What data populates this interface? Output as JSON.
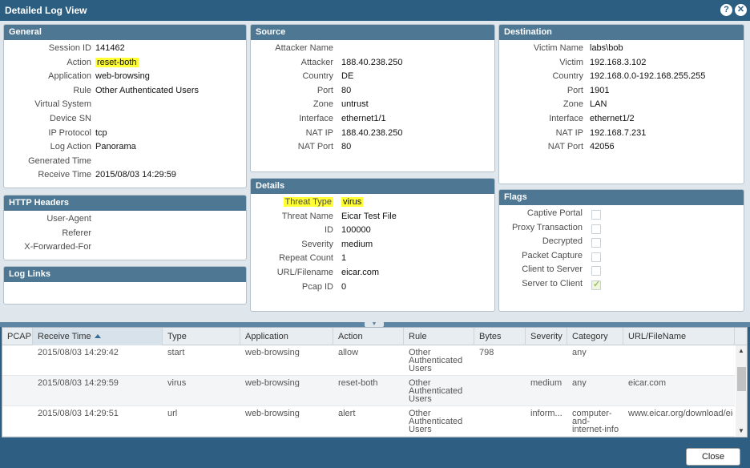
{
  "window": {
    "title": "Detailed Log View"
  },
  "general": {
    "header": "General",
    "rows": [
      {
        "label": "Session ID",
        "value": "141462"
      },
      {
        "label": "Action",
        "value": "reset-both"
      },
      {
        "label": "Application",
        "value": "web-browsing"
      },
      {
        "label": "Rule",
        "value": "Other Authenticated Users"
      },
      {
        "label": "Virtual System",
        "value": ""
      },
      {
        "label": "Device SN",
        "value": ""
      },
      {
        "label": "IP Protocol",
        "value": "tcp"
      },
      {
        "label": "Log Action",
        "value": "Panorama"
      },
      {
        "label": "Generated Time",
        "value": ""
      },
      {
        "label": "Receive Time",
        "value": "2015/08/03 14:29:59"
      }
    ]
  },
  "http_headers": {
    "header": "HTTP Headers",
    "rows": [
      {
        "label": "User-Agent",
        "value": ""
      },
      {
        "label": "Referer",
        "value": ""
      },
      {
        "label": "X-Forwarded-For",
        "value": ""
      }
    ]
  },
  "log_links": {
    "header": "Log Links"
  },
  "source": {
    "header": "Source",
    "rows": [
      {
        "label": "Attacker Name",
        "value": ""
      },
      {
        "label": "Attacker",
        "value": "188.40.238.250"
      },
      {
        "label": "Country",
        "value": "DE"
      },
      {
        "label": "Port",
        "value": "80"
      },
      {
        "label": "Zone",
        "value": "untrust"
      },
      {
        "label": "Interface",
        "value": "ethernet1/1"
      },
      {
        "label": "NAT IP",
        "value": "188.40.238.250"
      },
      {
        "label": "NAT Port",
        "value": "80"
      }
    ]
  },
  "details": {
    "header": "Details",
    "rows": [
      {
        "label": "Threat Type",
        "value": "virus"
      },
      {
        "label": "Threat Name",
        "value": "Eicar Test File"
      },
      {
        "label": "ID",
        "value": "100000"
      },
      {
        "label": "Severity",
        "value": "medium"
      },
      {
        "label": "Repeat Count",
        "value": "1"
      },
      {
        "label": "URL/Filename",
        "value": "eicar.com"
      },
      {
        "label": "Pcap ID",
        "value": "0"
      }
    ]
  },
  "destination": {
    "header": "Destination",
    "rows": [
      {
        "label": "Victim Name",
        "value": "labs\\bob"
      },
      {
        "label": "Victim",
        "value": "192.168.3.102"
      },
      {
        "label": "Country",
        "value": "192.168.0.0-192.168.255.255"
      },
      {
        "label": "Port",
        "value": "1901"
      },
      {
        "label": "Zone",
        "value": "LAN"
      },
      {
        "label": "Interface",
        "value": "ethernet1/2"
      },
      {
        "label": "NAT IP",
        "value": "192.168.7.231"
      },
      {
        "label": "NAT Port",
        "value": "42056"
      }
    ]
  },
  "flags": {
    "header": "Flags",
    "rows": [
      {
        "label": "Captive Portal",
        "checked": false
      },
      {
        "label": "Proxy Transaction",
        "checked": false
      },
      {
        "label": "Decrypted",
        "checked": false
      },
      {
        "label": "Packet Capture",
        "checked": false
      },
      {
        "label": "Client to Server",
        "checked": false
      },
      {
        "label": "Server to Client",
        "checked": true
      }
    ]
  },
  "table": {
    "columns": [
      "PCAP",
      "Receive Time",
      "Type",
      "Application",
      "Action",
      "Rule",
      "Bytes",
      "Severity",
      "Category",
      "URL/FileName"
    ],
    "sorted_column": "Receive Time",
    "sort_direction": "ascending",
    "rows": [
      {
        "pcap": "",
        "receive_time": "2015/08/03 14:29:42",
        "type": "start",
        "application": "web-browsing",
        "action": "allow",
        "rule": "Other Authenticated Users",
        "bytes": "798",
        "severity": "",
        "category": "any",
        "url": ""
      },
      {
        "pcap": "",
        "receive_time": "2015/08/03 14:29:59",
        "type": "virus",
        "application": "web-browsing",
        "action": "reset-both",
        "rule": "Other Authenticated Users",
        "bytes": "",
        "severity": "medium",
        "category": "any",
        "url": "eicar.com"
      },
      {
        "pcap": "",
        "receive_time": "2015/08/03 14:29:51",
        "type": "url",
        "application": "web-browsing",
        "action": "alert",
        "rule": "Other Authenticated Users",
        "bytes": "",
        "severity": "inform...",
        "category": "computer-and-internet-info",
        "url": "www.eicar.org/download/eic..."
      }
    ]
  },
  "footer": {
    "close_label": "Close"
  },
  "colors": {
    "title_bar": "#2b5e80",
    "panel_header": "#4e7793",
    "highlight": "#ffff33"
  }
}
